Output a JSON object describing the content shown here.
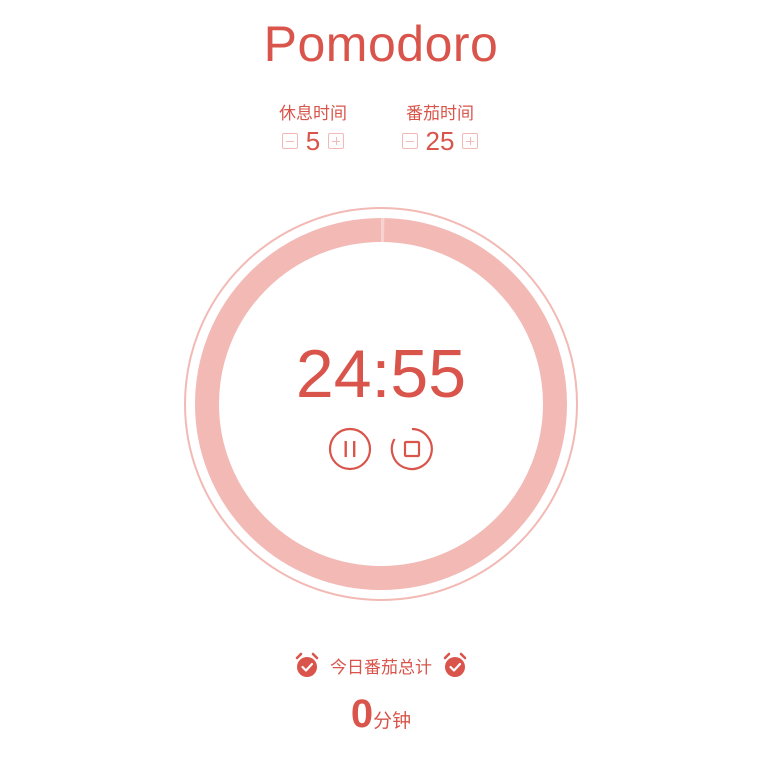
{
  "app": {
    "title": "Pomodoro"
  },
  "settings": {
    "break": {
      "label": "休息时间",
      "value": "5"
    },
    "work": {
      "label": "番茄时间",
      "value": "25"
    }
  },
  "timer": {
    "time": "24:55",
    "progress": 0.003
  },
  "summary": {
    "label": "今日番茄总计",
    "total": "0",
    "unit": "分钟"
  },
  "colors": {
    "accent": "#d9544b",
    "ring": "#f2b9b5"
  },
  "icons": {
    "decrement": "minus-square-icon",
    "increment": "plus-square-icon",
    "pause": "pause-circle-icon",
    "stop": "stop-circle-icon",
    "alarm": "alarm-clock-check-icon"
  }
}
